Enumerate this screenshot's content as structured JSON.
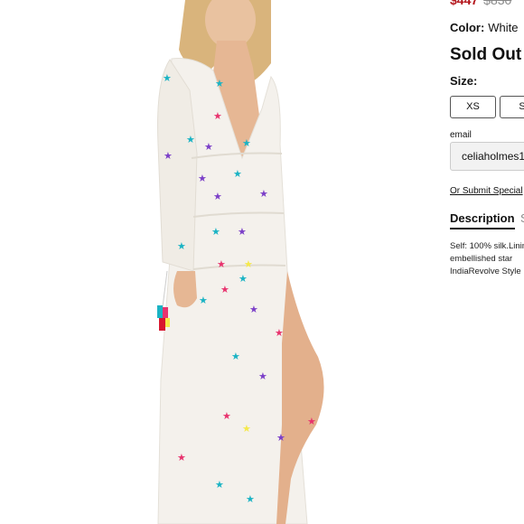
{
  "product": {
    "price_sale": "$447",
    "price_original": "$830",
    "color_label": "Color:",
    "color_value": "White",
    "availability": "Sold Out",
    "size_label": "Size:",
    "sizes": [
      "XS",
      "S"
    ],
    "email_label": "email",
    "email_value": "celiaholmes1",
    "submit_link": "Or Submit Special",
    "tabs": [
      "Description",
      "S"
    ],
    "description_lines": [
      "Self: 100% silk.Linin",
      "embellished star",
      "IndiaRevolve Style"
    ]
  },
  "colors": {
    "sale_price": "#b3141b",
    "star_palette": [
      "#e8336e",
      "#1ab3c4",
      "#7b3fc8",
      "#f5e94b",
      "#c83fa8"
    ]
  },
  "image": {
    "subject": "model wearing white sheer long-sleeve maxi dress with embroidered multicolor stars"
  }
}
